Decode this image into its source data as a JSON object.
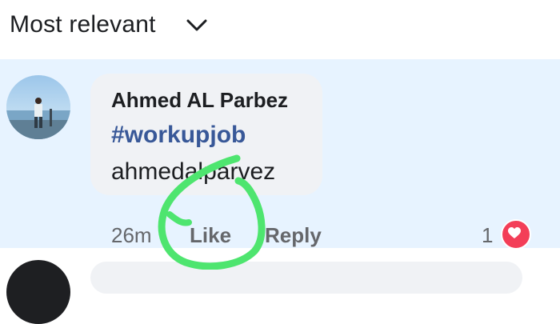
{
  "sort": {
    "label": "Most relevant"
  },
  "comment": {
    "author": "Ahmed AL Parbez",
    "hashtag": "#workupjob",
    "text": "ahmedalparvez",
    "timestamp": "26m",
    "like_label": "Like",
    "reply_label": "Reply",
    "reaction_count": "1",
    "reaction_icon": "heart-icon"
  },
  "colors": {
    "highlight_bg": "#e7f3ff",
    "bubble_bg": "#f0f2f5",
    "hashtag": "#385898",
    "meta_text": "#65676b",
    "heart": "#f33e58",
    "annotation_stroke": "#4ee56f"
  }
}
